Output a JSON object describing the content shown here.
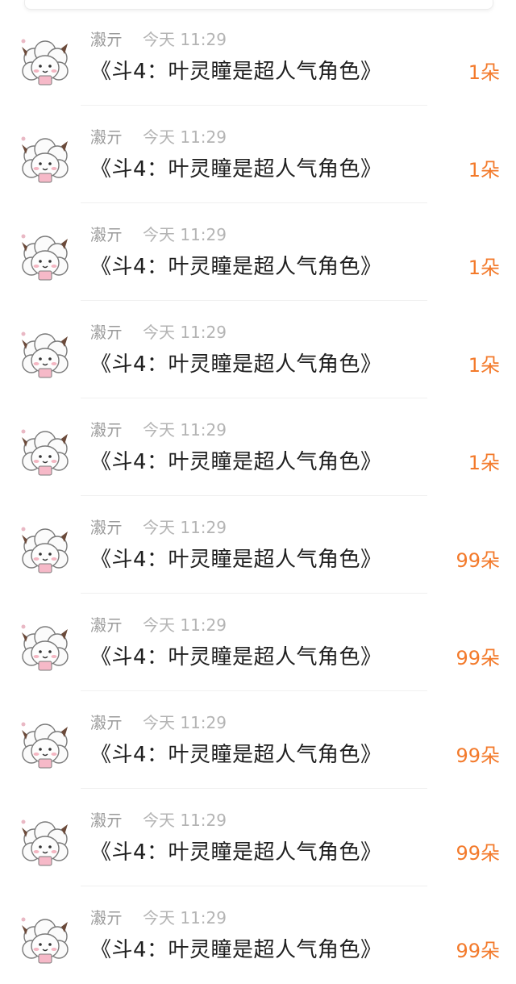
{
  "feed": {
    "items": [
      {
        "user": "瀫亓",
        "time": "今天 11:29",
        "title": "《斗4：叶灵瞳是超人气角色》",
        "gift": "1朵"
      },
      {
        "user": "瀫亓",
        "time": "今天 11:29",
        "title": "《斗4：叶灵瞳是超人气角色》",
        "gift": "1朵"
      },
      {
        "user": "瀫亓",
        "time": "今天 11:29",
        "title": "《斗4：叶灵瞳是超人气角色》",
        "gift": "1朵"
      },
      {
        "user": "瀫亓",
        "time": "今天 11:29",
        "title": "《斗4：叶灵瞳是超人气角色》",
        "gift": "1朵"
      },
      {
        "user": "瀫亓",
        "time": "今天 11:29",
        "title": "《斗4：叶灵瞳是超人气角色》",
        "gift": "1朵"
      },
      {
        "user": "瀫亓",
        "time": "今天 11:29",
        "title": "《斗4：叶灵瞳是超人气角色》",
        "gift": "99朵"
      },
      {
        "user": "瀫亓",
        "time": "今天 11:29",
        "title": "《斗4：叶灵瞳是超人气角色》",
        "gift": "99朵"
      },
      {
        "user": "瀫亓",
        "time": "今天 11:29",
        "title": "《斗4：叶灵瞳是超人气角色》",
        "gift": "99朵"
      },
      {
        "user": "瀫亓",
        "time": "今天 11:29",
        "title": "《斗4：叶灵瞳是超人气角色》",
        "gift": "99朵"
      },
      {
        "user": "瀫亓",
        "time": "今天 11:29",
        "title": "《斗4：叶灵瞳是超人气角色》",
        "gift": "99朵"
      }
    ],
    "avatar_icon": "sheep-avatar-icon",
    "colors": {
      "gift_accent": "#f37a2b",
      "name": "#9a9a9a",
      "time": "#b4b4b4",
      "title": "#1f1f1f"
    }
  }
}
